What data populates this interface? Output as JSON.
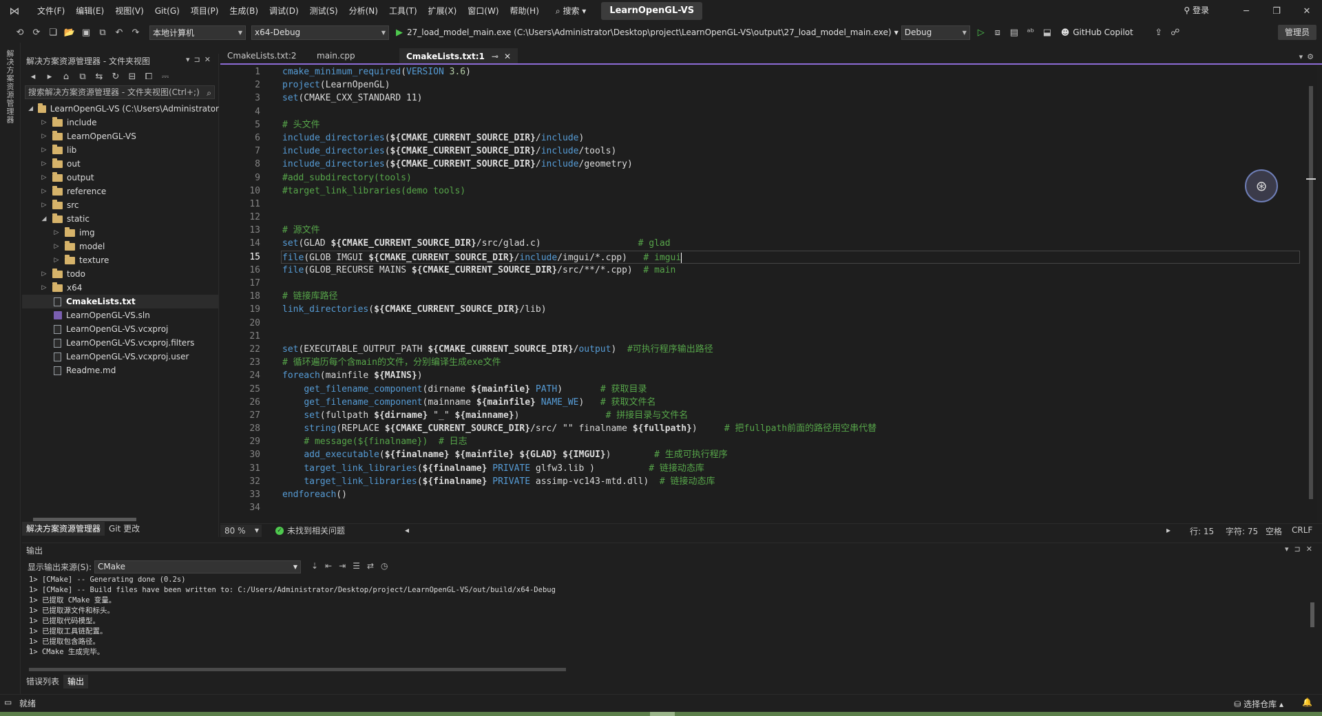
{
  "menubar": {
    "items": [
      "文件(F)",
      "编辑(E)",
      "视图(V)",
      "Git(G)",
      "项目(P)",
      "生成(B)",
      "调试(D)",
      "测试(S)",
      "分析(N)",
      "工具(T)",
      "扩展(X)",
      "窗口(W)",
      "帮助(H)"
    ],
    "search_label": "搜索",
    "solution_name": "LearnOpenGL-VS",
    "login_label": "登录"
  },
  "toolbar": {
    "target_machine": "本地计算机",
    "platform": "x64-Debug",
    "run_target": "27_load_model_main.exe (C:\\Users\\Administrator\\Desktop\\project\\LearnOpenGL-VS\\output\\27_load_model_main.exe)",
    "config": "Debug",
    "copilot_label": "GitHub Copilot",
    "admin_label": "管理员"
  },
  "left_rail": {
    "label": "解决方案资源管理器"
  },
  "solution_explorer": {
    "title": "解决方案资源管理器 - 文件夹视图",
    "search_placeholder": "搜索解决方案资源管理器 - 文件夹视图(Ctrl+;)",
    "tree": [
      {
        "label": "LearnOpenGL-VS (C:\\Users\\Administrator",
        "depth": 0,
        "kind": "folder",
        "expand": "open"
      },
      {
        "label": "include",
        "depth": 1,
        "kind": "folder",
        "expand": "closed"
      },
      {
        "label": "LearnOpenGL-VS",
        "depth": 1,
        "kind": "folder",
        "expand": "closed"
      },
      {
        "label": "lib",
        "depth": 1,
        "kind": "folder",
        "expand": "closed"
      },
      {
        "label": "out",
        "depth": 1,
        "kind": "folder",
        "expand": "closed"
      },
      {
        "label": "output",
        "depth": 1,
        "kind": "folder",
        "expand": "closed"
      },
      {
        "label": "reference",
        "depth": 1,
        "kind": "folder",
        "expand": "closed"
      },
      {
        "label": "src",
        "depth": 1,
        "kind": "folder",
        "expand": "closed"
      },
      {
        "label": "static",
        "depth": 1,
        "kind": "folder",
        "expand": "open"
      },
      {
        "label": "img",
        "depth": 2,
        "kind": "folder",
        "expand": "closed"
      },
      {
        "label": "model",
        "depth": 2,
        "kind": "folder",
        "expand": "closed"
      },
      {
        "label": "texture",
        "depth": 2,
        "kind": "folder",
        "expand": "closed"
      },
      {
        "label": "todo",
        "depth": 1,
        "kind": "folder",
        "expand": "closed"
      },
      {
        "label": "x64",
        "depth": 1,
        "kind": "folder",
        "expand": "closed"
      },
      {
        "label": "CmakeLists.txt",
        "depth": 1,
        "kind": "file",
        "expand": "none",
        "bold": true
      },
      {
        "label": "LearnOpenGL-VS.sln",
        "depth": 1,
        "kind": "sln",
        "expand": "none"
      },
      {
        "label": "LearnOpenGL-VS.vcxproj",
        "depth": 1,
        "kind": "file",
        "expand": "none"
      },
      {
        "label": "LearnOpenGL-VS.vcxproj.filters",
        "depth": 1,
        "kind": "file",
        "expand": "none"
      },
      {
        "label": "LearnOpenGL-VS.vcxproj.user",
        "depth": 1,
        "kind": "file",
        "expand": "none"
      },
      {
        "label": "Readme.md",
        "depth": 1,
        "kind": "file",
        "expand": "none"
      }
    ],
    "bottom_tabs": [
      "解决方案资源管理器",
      "Git 更改"
    ]
  },
  "editor": {
    "tabs": [
      {
        "label": "CmakeLists.txt:2",
        "active": false
      },
      {
        "label": "main.cpp",
        "active": false
      },
      {
        "label": "CmakeLists.txt:1",
        "active": true,
        "pin": "⊸",
        "close": "✕"
      }
    ],
    "current_line": 15,
    "lines": [
      [
        [
          "kw",
          "cmake_minimum_required"
        ],
        [
          "",
          "("
        ],
        [
          "kw",
          "VERSION"
        ],
        [
          "num",
          " 3.6"
        ],
        [
          "",
          ")"
        ]
      ],
      [
        [
          "kw",
          "project"
        ],
        [
          "",
          "(LearnOpenGL)"
        ]
      ],
      [
        [
          "kw",
          "set"
        ],
        [
          "",
          "(CMAKE_CXX_STANDARD 11)"
        ]
      ],
      [],
      [
        [
          "cm",
          "# 头文件"
        ]
      ],
      [
        [
          "kw",
          "include_directories"
        ],
        [
          "",
          "("
        ],
        [
          "var",
          "${CMAKE_CURRENT_SOURCE_DIR}"
        ],
        [
          "",
          "/"
        ],
        [
          "kw",
          "include"
        ],
        [
          "",
          ")"
        ]
      ],
      [
        [
          "kw",
          "include_directories"
        ],
        [
          "",
          "("
        ],
        [
          "var",
          "${CMAKE_CURRENT_SOURCE_DIR}"
        ],
        [
          "",
          "/"
        ],
        [
          "kw",
          "include"
        ],
        [
          "",
          "/tools)"
        ]
      ],
      [
        [
          "kw",
          "include_directories"
        ],
        [
          "",
          "("
        ],
        [
          "var",
          "${CMAKE_CURRENT_SOURCE_DIR}"
        ],
        [
          "",
          "/"
        ],
        [
          "kw",
          "include"
        ],
        [
          "",
          "/geometry)"
        ]
      ],
      [
        [
          "cm",
          "#add_subdirectory(tools)"
        ]
      ],
      [
        [
          "cm",
          "#target_link_libraries(demo tools)"
        ]
      ],
      [],
      [],
      [
        [
          "cm",
          "# 源文件"
        ]
      ],
      [
        [
          "kw",
          "set"
        ],
        [
          "",
          "(GLAD "
        ],
        [
          "var",
          "${CMAKE_CURRENT_SOURCE_DIR}"
        ],
        [
          "",
          "/src/glad.c)                  "
        ],
        [
          "cm",
          "# glad"
        ]
      ],
      [
        [
          "kw",
          "file"
        ],
        [
          "",
          "(GLOB IMGUI "
        ],
        [
          "var",
          "${CMAKE_CURRENT_SOURCE_DIR}"
        ],
        [
          "",
          "/"
        ],
        [
          "kw",
          "include"
        ],
        [
          "",
          "/imgui/*.cpp)   "
        ],
        [
          "cm",
          "# imgui"
        ],
        [
          "cursor",
          ""
        ]
      ],
      [
        [
          "kw",
          "file"
        ],
        [
          "",
          "(GLOB_RECURSE MAINS "
        ],
        [
          "var",
          "${CMAKE_CURRENT_SOURCE_DIR}"
        ],
        [
          "",
          "/src/**/*.cpp)  "
        ],
        [
          "cm",
          "# main"
        ]
      ],
      [],
      [
        [
          "cm",
          "# 链接库路径"
        ]
      ],
      [
        [
          "kw",
          "link_directories"
        ],
        [
          "",
          "("
        ],
        [
          "var",
          "${CMAKE_CURRENT_SOURCE_DIR}"
        ],
        [
          "",
          "/lib)"
        ]
      ],
      [],
      [],
      [
        [
          "kw",
          "set"
        ],
        [
          "",
          "(EXECUTABLE_OUTPUT_PATH "
        ],
        [
          "var",
          "${CMAKE_CURRENT_SOURCE_DIR}"
        ],
        [
          "",
          "/"
        ],
        [
          "kw",
          "output"
        ],
        [
          "",
          ")  "
        ],
        [
          "cm",
          "#可执行程序输出路径"
        ]
      ],
      [
        [
          "cm",
          "# 循环遍历每个含main的文件，分别编译生成exe文件"
        ]
      ],
      [
        [
          "kw",
          "foreach"
        ],
        [
          "",
          "(mainfile "
        ],
        [
          "var",
          "${MAINS}"
        ],
        [
          "",
          ")"
        ]
      ],
      [
        [
          "",
          "    "
        ],
        [
          "kw",
          "get_filename_component"
        ],
        [
          "",
          "(dirname "
        ],
        [
          "var",
          "${mainfile}"
        ],
        [
          "kw",
          " PATH"
        ],
        [
          "",
          ")       "
        ],
        [
          "cm",
          "# 获取目录"
        ]
      ],
      [
        [
          "",
          "    "
        ],
        [
          "kw",
          "get_filename_component"
        ],
        [
          "",
          "(mainname "
        ],
        [
          "var",
          "${mainfile}"
        ],
        [
          "kw",
          " NAME_WE"
        ],
        [
          "",
          ")   "
        ],
        [
          "cm",
          "# 获取文件名"
        ]
      ],
      [
        [
          "",
          "    "
        ],
        [
          "kw",
          "set"
        ],
        [
          "",
          "(fullpath "
        ],
        [
          "var",
          "${dirname}"
        ],
        [
          "",
          " \"_\" "
        ],
        [
          "var",
          "${mainname}"
        ],
        [
          "",
          ")                "
        ],
        [
          "cm",
          "# 拼接目录与文件名"
        ]
      ],
      [
        [
          "",
          "    "
        ],
        [
          "kw",
          "string"
        ],
        [
          "",
          "(REPLACE "
        ],
        [
          "var",
          "${CMAKE_CURRENT_SOURCE_DIR}"
        ],
        [
          "",
          "/src/ \"\" finalname "
        ],
        [
          "var",
          "${fullpath}"
        ],
        [
          "",
          ")     "
        ],
        [
          "cm",
          "# 把fullpath前面的路径用空串代替"
        ]
      ],
      [
        [
          "",
          "    "
        ],
        [
          "cm",
          "# message(${finalname})  # 日志"
        ]
      ],
      [
        [
          "",
          "    "
        ],
        [
          "kw",
          "add_executable"
        ],
        [
          "",
          "("
        ],
        [
          "var",
          "${finalname}"
        ],
        [
          "",
          " "
        ],
        [
          "var",
          "${mainfile}"
        ],
        [
          "",
          " "
        ],
        [
          "var",
          "${GLAD}"
        ],
        [
          "",
          " "
        ],
        [
          "var",
          "${IMGUI}"
        ],
        [
          "",
          ")        "
        ],
        [
          "cm",
          "# 生成可执行程序"
        ]
      ],
      [
        [
          "",
          "    "
        ],
        [
          "kw",
          "target_link_libraries"
        ],
        [
          "",
          "("
        ],
        [
          "var",
          "${finalname}"
        ],
        [
          "kw",
          " PRIVATE"
        ],
        [
          "",
          " glfw3.lib )          "
        ],
        [
          "cm",
          "# 链接动态库"
        ]
      ],
      [
        [
          "",
          "    "
        ],
        [
          "kw",
          "target_link_libraries"
        ],
        [
          "",
          "("
        ],
        [
          "var",
          "${finalname}"
        ],
        [
          "kw",
          " PRIVATE"
        ],
        [
          "",
          " assimp-vc143-mtd.dll)  "
        ],
        [
          "cm",
          "# 链接动态库"
        ]
      ],
      [
        [
          "kw",
          "endforeach"
        ],
        [
          "",
          "()"
        ]
      ],
      []
    ]
  },
  "editor_status": {
    "zoom": "80 %",
    "issues": "未找到相关问题",
    "line": "行: 15",
    "col": "字符: 75",
    "indent": "空格",
    "eol": "CRLF"
  },
  "output": {
    "title": "输出",
    "source_label": "显示输出来源(S):",
    "source": "CMake",
    "lines": [
      "1> [CMake] -- Generating done (0.2s)",
      "1> [CMake] -- Build files have been written to: C:/Users/Administrator/Desktop/project/LearnOpenGL-VS/out/build/x64-Debug",
      "1> 已提取 CMake 变量。",
      "1> 已提取源文件和标头。",
      "1> 已提取代码模型。",
      "1> 已提取工具链配置。",
      "1> 已提取包含路径。",
      "1> CMake 生成完毕。"
    ],
    "tabs": [
      "错误列表",
      "输出"
    ]
  },
  "statusbar": {
    "ready": "就绪",
    "repo": "选择仓库"
  },
  "colors": {
    "accent": "#8c6bd6",
    "keyword": "#569cd6",
    "comment": "#57a64a",
    "ok": "#4ec94e"
  }
}
